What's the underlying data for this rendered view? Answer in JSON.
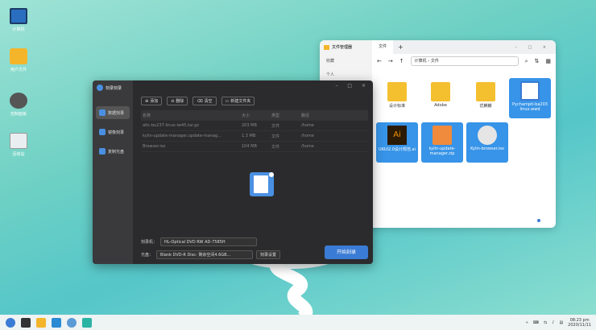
{
  "desktop": {
    "icons": [
      {
        "label": "计算机",
        "icon": "computer-icon"
      },
      {
        "label": "用户文件",
        "icon": "home-folder-icon"
      },
      {
        "label": "控制面板",
        "icon": "settings-gear-icon"
      },
      {
        "label": "回收站",
        "icon": "recycle-bin-icon"
      }
    ]
  },
  "file_manager": {
    "tab_title": "文件管理器",
    "tab2": "文件",
    "sidebar": [
      "收藏",
      "个人"
    ],
    "address": [
      "计算机",
      "文件"
    ],
    "files": [
      {
        "name": "设计标准",
        "type": "folder"
      },
      {
        "name": "Adobe",
        "type": "folder"
      },
      {
        "name": "优麒麟",
        "type": "folder"
      },
      {
        "name": "Pychampit-ba203 linux.wwd",
        "type": "doc",
        "selected": true
      },
      {
        "name": "UKUI2.0设计规范.ai",
        "type": "ai",
        "selected": true
      },
      {
        "name": "kylin-update-manager.zip",
        "type": "zip",
        "selected": true
      },
      {
        "name": "Kylin-browser.iso",
        "type": "iso",
        "selected": true
      }
    ]
  },
  "burner": {
    "title": "刻录刻录",
    "nav": [
      "数据刻录",
      "镜像刻录",
      "复制光盘"
    ],
    "toolbar": [
      "添加",
      "删除",
      "清空",
      "新建文件夹"
    ],
    "table": {
      "headers": [
        "名称",
        "大小",
        "类型",
        "路径"
      ],
      "rows": [
        {
          "name": "atlc-bu237-linux-iw45.tar.gz",
          "size": "203 MB",
          "type": "文件",
          "path": "/home"
        },
        {
          "name": "kylin-update-manager.update-manag...",
          "size": "1.3 MB",
          "type": "文件",
          "path": "/home"
        },
        {
          "name": "Browser.iso",
          "size": "104 MB",
          "type": "文件",
          "path": "/home"
        }
      ]
    },
    "target_label": "刻录机：",
    "target_value": "HL-Optical DVD RW AD-7585H",
    "disc_label": "光盘：",
    "disc_value": "Blank DVD-R Disc: 剩余空间4.6GB...",
    "settings_label": "刻录设置",
    "burn_label": "开始刻录"
  },
  "taskbar": {
    "time": "08:23 pm",
    "date": "2020/11/11"
  }
}
